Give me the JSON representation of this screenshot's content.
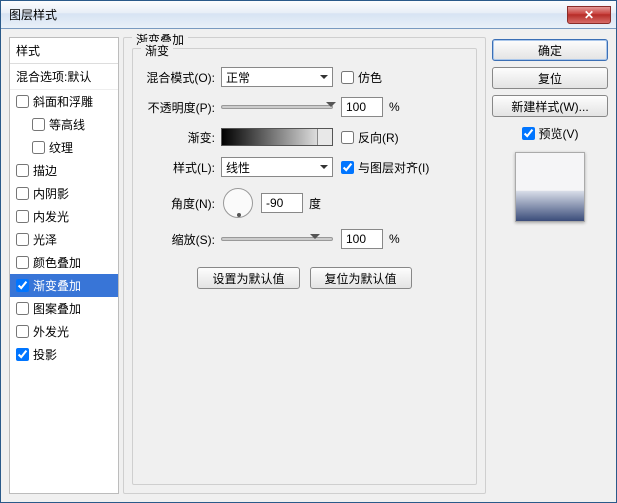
{
  "window": {
    "title": "图层样式"
  },
  "left": {
    "header": "样式",
    "subheader": "混合选项:默认",
    "items": [
      {
        "label": "斜面和浮雕",
        "checked": false,
        "selected": false,
        "indent": false
      },
      {
        "label": "等高线",
        "checked": false,
        "selected": false,
        "indent": true
      },
      {
        "label": "纹理",
        "checked": false,
        "selected": false,
        "indent": true
      },
      {
        "label": "描边",
        "checked": false,
        "selected": false,
        "indent": false
      },
      {
        "label": "内阴影",
        "checked": false,
        "selected": false,
        "indent": false
      },
      {
        "label": "内发光",
        "checked": false,
        "selected": false,
        "indent": false
      },
      {
        "label": "光泽",
        "checked": false,
        "selected": false,
        "indent": false
      },
      {
        "label": "颜色叠加",
        "checked": false,
        "selected": false,
        "indent": false
      },
      {
        "label": "渐变叠加",
        "checked": true,
        "selected": true,
        "indent": false
      },
      {
        "label": "图案叠加",
        "checked": false,
        "selected": false,
        "indent": false
      },
      {
        "label": "外发光",
        "checked": false,
        "selected": false,
        "indent": false
      },
      {
        "label": "投影",
        "checked": true,
        "selected": false,
        "indent": false
      }
    ]
  },
  "center": {
    "group_label": "渐变叠加",
    "inner_label": "渐变",
    "blend_mode": {
      "label": "混合模式(O):",
      "value": "正常"
    },
    "dither": {
      "label": "仿色",
      "checked": false
    },
    "opacity": {
      "label": "不透明度(P):",
      "value": "100",
      "unit": "%"
    },
    "gradient": {
      "label": "渐变:"
    },
    "reverse": {
      "label": "反向(R)",
      "checked": false
    },
    "style": {
      "label": "样式(L):",
      "value": "线性"
    },
    "align": {
      "label": "与图层对齐(I)",
      "checked": true
    },
    "angle": {
      "label": "角度(N):",
      "value": "-90",
      "unit": "度"
    },
    "scale": {
      "label": "缩放(S):",
      "value": "100",
      "unit": "%"
    },
    "buttons": {
      "default": "设置为默认值",
      "reset": "复位为默认值"
    }
  },
  "right": {
    "ok": "确定",
    "cancel": "复位",
    "new_style": "新建样式(W)...",
    "preview": {
      "label": "预览(V)",
      "checked": true
    }
  }
}
